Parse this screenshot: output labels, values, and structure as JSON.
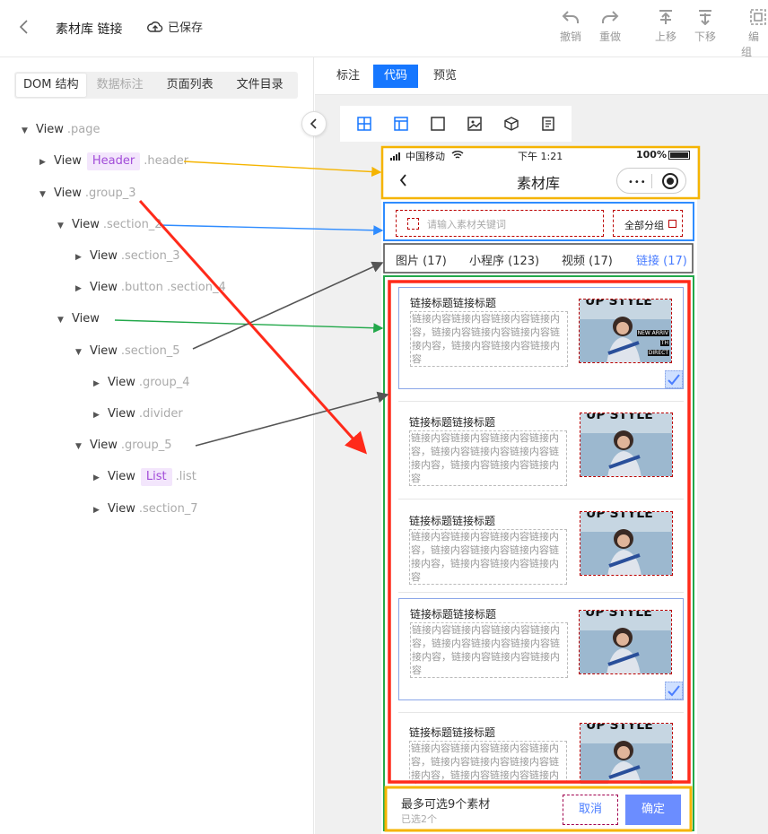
{
  "topbar": {
    "title": "素材库 链接",
    "saved": "已保存",
    "tools": [
      {
        "label": "撤销",
        "icon": "undo-icon"
      },
      {
        "label": "重做",
        "icon": "redo-icon"
      },
      {
        "label": "上移",
        "icon": "move-up-icon"
      },
      {
        "label": "下移",
        "icon": "move-down-icon"
      },
      {
        "label": "编组",
        "icon": "group-icon"
      }
    ]
  },
  "left_tabs": [
    "DOM 结构",
    "数据标注",
    "页面列表",
    "文件目录"
  ],
  "tree": [
    {
      "label": "View",
      "cls": ".page",
      "tag": ""
    },
    {
      "label": "View",
      "cls": ".header",
      "tag": "Header"
    },
    {
      "label": "View",
      "cls": ".group_3",
      "tag": ""
    },
    {
      "label": "View",
      "cls": ".section_2",
      "tag": ""
    },
    {
      "label": "View",
      "cls": ".section_3",
      "tag": ""
    },
    {
      "label": "View",
      "cls": ".button .section_4",
      "tag": ""
    },
    {
      "label": "View",
      "cls": "",
      "tag": ""
    },
    {
      "label": "View",
      "cls": ".section_5",
      "tag": ""
    },
    {
      "label": "View",
      "cls": ".group_4",
      "tag": ""
    },
    {
      "label": "View",
      "cls": ".divider",
      "tag": ""
    },
    {
      "label": "View",
      "cls": ".group_5",
      "tag": ""
    },
    {
      "label": "View",
      "cls": ".list",
      "tag": "List"
    },
    {
      "label": "View",
      "cls": ".section_7",
      "tag": ""
    }
  ],
  "view_tabs": [
    "标注",
    "代码",
    "预览"
  ],
  "phone": {
    "carrier": "中国移动",
    "time": "下午 1:21",
    "battery": "100%",
    "page_title": "素材库",
    "search_placeholder": "请输入素材关键词",
    "group_button": "全部分组",
    "categories": [
      "图片 (17)",
      "小程序 (123)",
      "视频 (17)",
      "链接 (17)"
    ],
    "cards": [
      {
        "title": "链接标题链接标题",
        "desc": "链接内容链接内容链接内容链接内容，链接内容链接内容链接内容链接内容，链接内容链接内容链接内容",
        "selected": true
      },
      {
        "title": "链接标题链接标题",
        "desc": "链接内容链接内容链接内容链接内容，链接内容链接内容链接内容链接内容，链接内容链接内容链接内容",
        "selected": false
      },
      {
        "title": "链接标题链接标题",
        "desc": "链接内容链接内容链接内容链接内容，链接内容链接内容链接内容链接内容，链接内容链接内容链接内容",
        "selected": false
      },
      {
        "title": "链接标题链接标题",
        "desc": "链接内容链接内容链接内容链接内容，链接内容链接内容链接内容链接内容，链接内容链接内容链接内容",
        "selected": true
      },
      {
        "title": "链接标题链接标题",
        "desc": "链接内容链接内容链接内容链接内容，链接内容链接内容链接内容链接内容，链接内容链接内容链接内容",
        "selected": false
      }
    ],
    "image_text": "UP STYLE",
    "image_sub": [
      "NEW ARRIV",
      "TH",
      "DIRECT"
    ],
    "bottom_hint": "最多可选9个素材",
    "bottom_count": "已选2个",
    "cancel": "取消",
    "confirm": "确定"
  },
  "colors": {
    "accent": "#1677ff",
    "confirm": "#6b8dff",
    "tag_bg": "#f3e6fc",
    "tag_text": "#a14bd8",
    "anno_orange": "#f5b400",
    "anno_blue": "#2f8cff",
    "anno_green": "#22a84a",
    "anno_red": "#ff2a1a",
    "anno_dark": "#555555"
  }
}
